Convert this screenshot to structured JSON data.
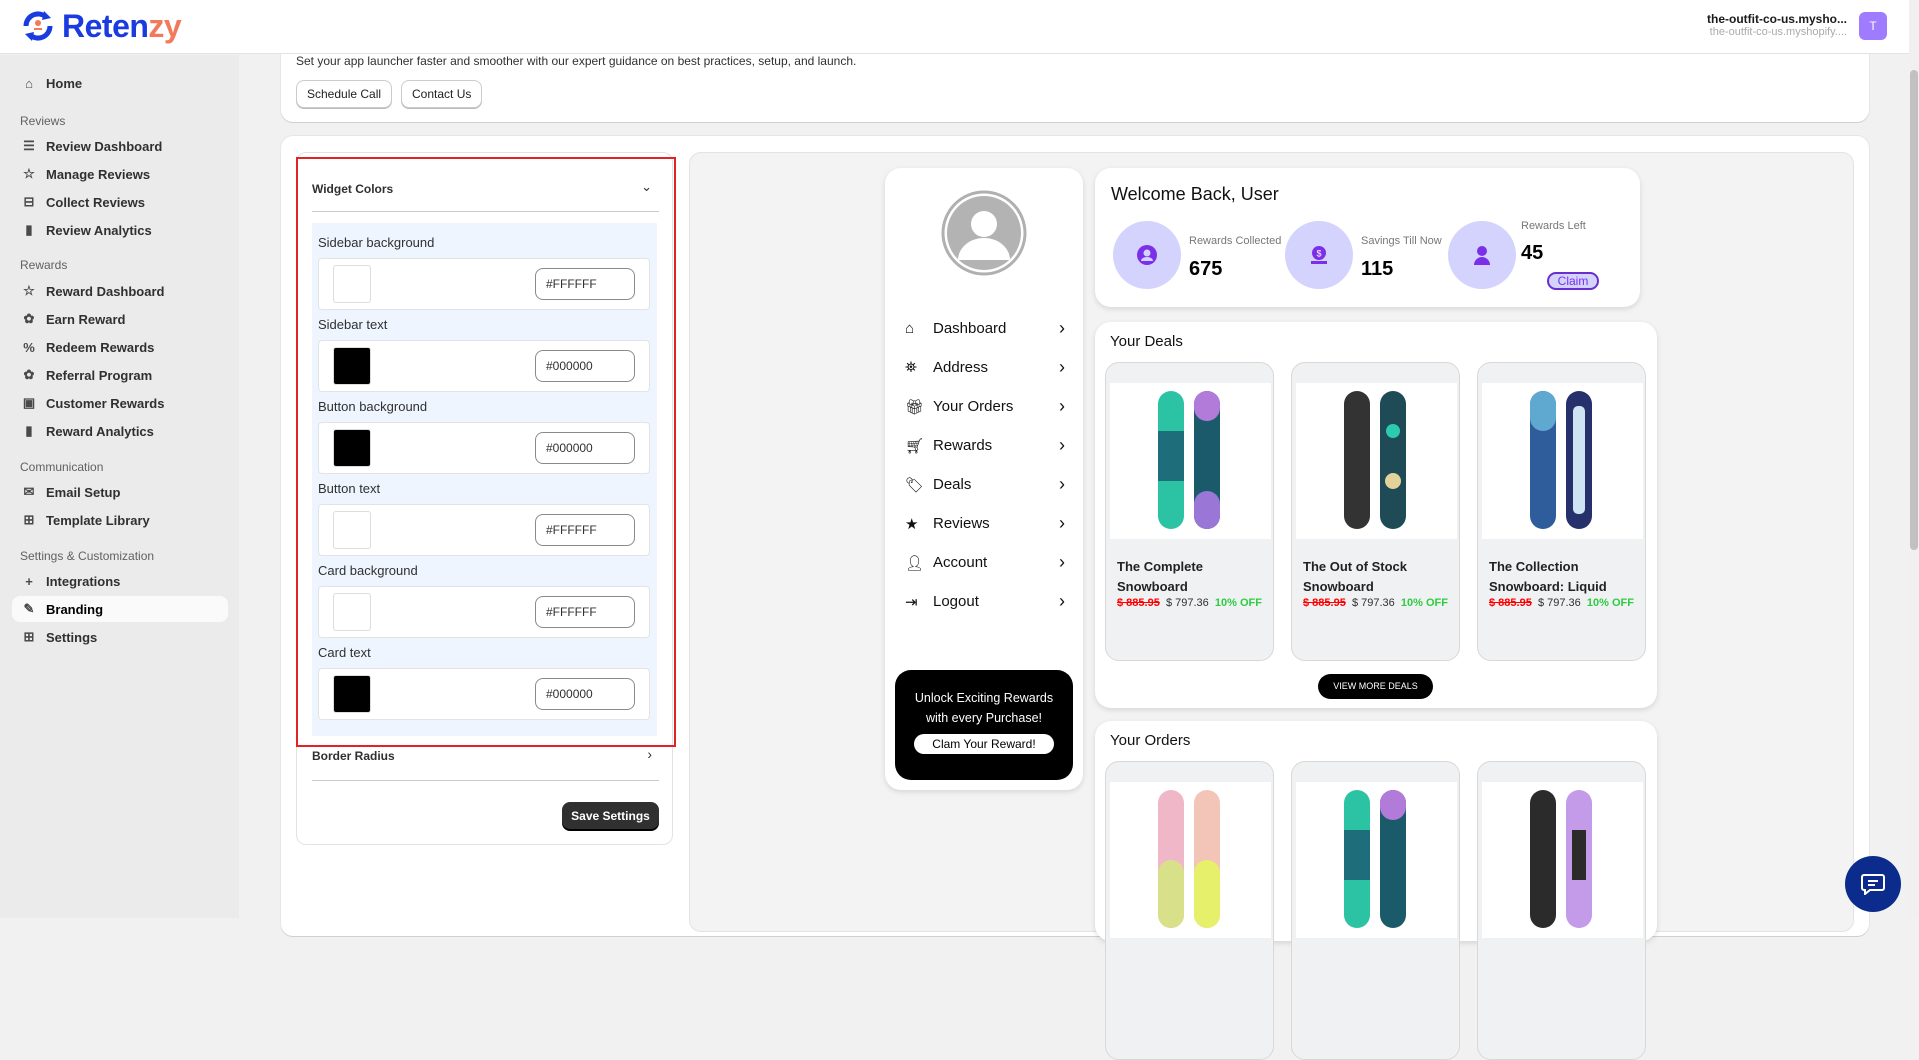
{
  "header": {
    "brand": "Retenzy",
    "brand_a": "Reten",
    "brand_b": "zy",
    "shop_name": "the-outfit-co-us.mysho...",
    "shop_domain": "the-outfit-co-us.myshopify....",
    "avatar_initial": "T"
  },
  "sidebar": {
    "home": "Home",
    "sections": [
      {
        "label": "Reviews",
        "items": [
          "Review Dashboard",
          "Manage Reviews",
          "Collect Reviews",
          "Review Analytics"
        ]
      },
      {
        "label": "Rewards",
        "items": [
          "Reward Dashboard",
          "Earn Reward",
          "Redeem Rewards",
          "Referral Program",
          "Customer Rewards",
          "Reward Analytics"
        ]
      },
      {
        "label": "Communication",
        "items": [
          "Email Setup",
          "Template Library"
        ]
      },
      {
        "label": "Settings & Customization",
        "items": [
          "Integrations",
          "Branding",
          "Settings"
        ]
      }
    ],
    "active": "Branding"
  },
  "guide": {
    "text": "Set your app launcher faster and smoother with our expert guidance on best practices, setup, and launch.",
    "schedule": "Schedule Call",
    "contact": "Contact Us"
  },
  "settings": {
    "widget_colors": "Widget Colors",
    "fields": [
      {
        "label": "Sidebar background",
        "value": "#FFFFFF",
        "color": "#FFFFFF"
      },
      {
        "label": "Sidebar text",
        "value": "#000000",
        "color": "#000000"
      },
      {
        "label": "Button background",
        "value": "#000000",
        "color": "#000000"
      },
      {
        "label": "Button text",
        "value": "#FFFFFF",
        "color": "#FFFFFF"
      },
      {
        "label": "Card background",
        "value": "#FFFFFF",
        "color": "#FFFFFF"
      },
      {
        "label": "Card text",
        "value": "#000000",
        "color": "#000000"
      }
    ],
    "border_radius": "Border Radius",
    "save": "Save Settings"
  },
  "preview": {
    "menu": [
      "Dashboard",
      "Address",
      "Your Orders",
      "Rewards",
      "Deals",
      "Reviews",
      "Account",
      "Logout"
    ],
    "promo": {
      "line1": "Unlock Exciting Rewards",
      "line2": "with every Purchase!",
      "button": "Clam Your Reward!"
    },
    "welcome": "Welcome Back, User",
    "stats": [
      {
        "label": "Rewards Collected",
        "value": "675"
      },
      {
        "label": "Savings Till Now",
        "value": "115"
      },
      {
        "label": "Rewards Left",
        "value": "45"
      }
    ],
    "claim": "Claim",
    "deals_title": "Your Deals",
    "deals": [
      {
        "name": "The Complete Snowboard",
        "old": "$ 885.95",
        "price": "$ 797.36",
        "off": "10% OFF"
      },
      {
        "name": "The Out of Stock Snowboard",
        "old": "$ 885.95",
        "price": "$ 797.36",
        "off": "10% OFF"
      },
      {
        "name": "The Collection Snowboard: Liquid",
        "old": "$ 885.95",
        "price": "$ 797.36",
        "off": "10% OFF"
      }
    ],
    "view_more": "VIEW MORE DEALS",
    "orders_title": "Your Orders"
  },
  "colors": {
    "accent": "#1a3be0",
    "highlight": "#e02424",
    "stat_bg": "#d3d3fe",
    "stat_icon": "#7b2fe8"
  }
}
